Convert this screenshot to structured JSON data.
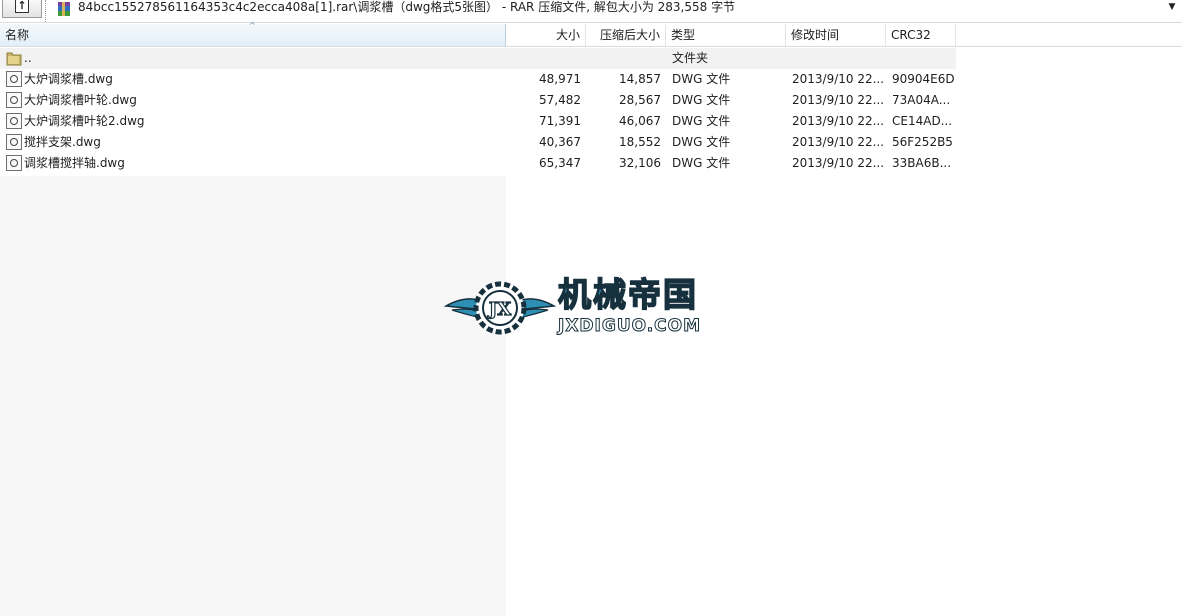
{
  "address_bar": {
    "path": "84bcc155278561164353c4c2ecca408a[1].rar\\调浆槽（dwg格式5张图） - RAR 压缩文件, 解包大小为 283,558 字节",
    "up_icon": "up-folder-icon",
    "archive_icon": "rar-archive-icon",
    "dropdown_icon": "chevron-down-icon"
  },
  "columns": {
    "name": "名称",
    "size": "大小",
    "packed": "压缩后大小",
    "type": "类型",
    "modified": "修改时间",
    "crc": "CRC32"
  },
  "parent_row": {
    "name": "..",
    "type": "文件夹",
    "icon": "folder-icon"
  },
  "files": [
    {
      "name": "大炉调浆槽.dwg",
      "size": "48,971",
      "packed": "14,857",
      "type": "DWG 文件",
      "modified": "2013/9/10 22...",
      "crc": "90904E6D",
      "icon": "dwg-file-icon"
    },
    {
      "name": "大炉调浆槽叶轮.dwg",
      "size": "57,482",
      "packed": "28,567",
      "type": "DWG 文件",
      "modified": "2013/9/10 22...",
      "crc": "73A04A...",
      "icon": "dwg-file-icon"
    },
    {
      "name": "大炉调浆槽叶轮2.dwg",
      "size": "71,391",
      "packed": "46,067",
      "type": "DWG 文件",
      "modified": "2013/9/10 22...",
      "crc": "CE14AD...",
      "icon": "dwg-file-icon"
    },
    {
      "name": "搅拌支架.dwg",
      "size": "40,367",
      "packed": "18,552",
      "type": "DWG 文件",
      "modified": "2013/9/10 22...",
      "crc": "56F252B5",
      "icon": "dwg-file-icon"
    },
    {
      "name": "调浆槽搅拌轴.dwg",
      "size": "65,347",
      "packed": "32,106",
      "type": "DWG 文件",
      "modified": "2013/9/10 22...",
      "crc": "33BA6B...",
      "icon": "dwg-file-icon"
    }
  ],
  "watermark": {
    "title": "机械帝国",
    "url": "JXDIGUO.COM",
    "emblem_text": "JX",
    "emblem_icon": "winged-gear-logo",
    "colors": {
      "fill": "#2c8fb3",
      "outline": "#16303d"
    }
  }
}
